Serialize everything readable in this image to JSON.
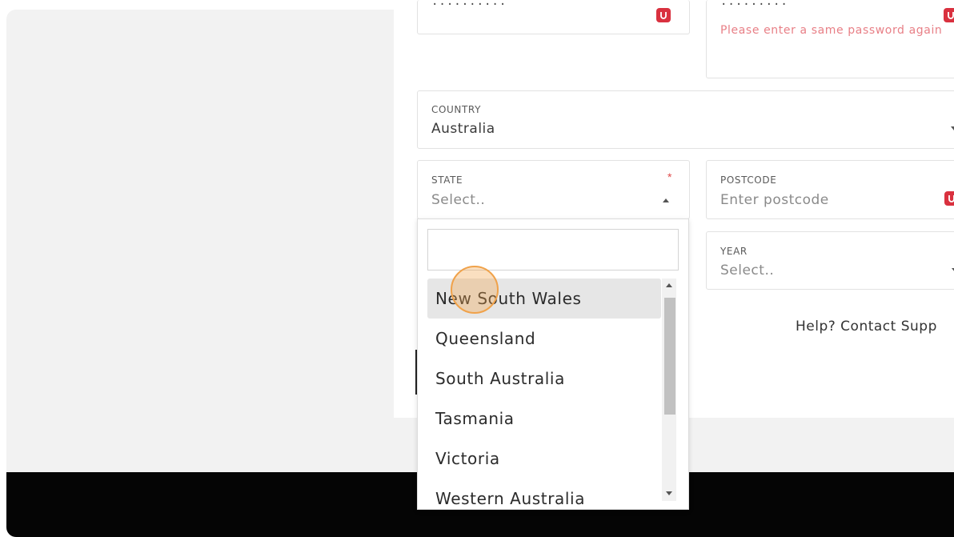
{
  "form": {
    "password": {
      "dots": "··········"
    },
    "confirm_password": {
      "dots": "·········",
      "error": "Please enter a same password again"
    },
    "country": {
      "label": "COUNTRY",
      "value": "Australia"
    },
    "state": {
      "label": "STATE",
      "placeholder": "Select..",
      "required_mark": "*"
    },
    "postcode": {
      "label": "POSTCODE",
      "placeholder": "Enter postcode"
    },
    "year": {
      "label": "YEAR",
      "placeholder": "Select.."
    },
    "help_text": "Help? Contact Supp"
  },
  "state_dropdown": {
    "search_value": "",
    "options": [
      "New South Wales",
      "Queensland",
      "South Australia",
      "Tasmania",
      "Victoria",
      "Western Australia"
    ],
    "highlighted": "New South Wales"
  },
  "colors": {
    "error": "#e87f86",
    "password_manager_icon": "#d9313f",
    "footer": "#050505",
    "cursor_highlight": "#f0a24a"
  }
}
